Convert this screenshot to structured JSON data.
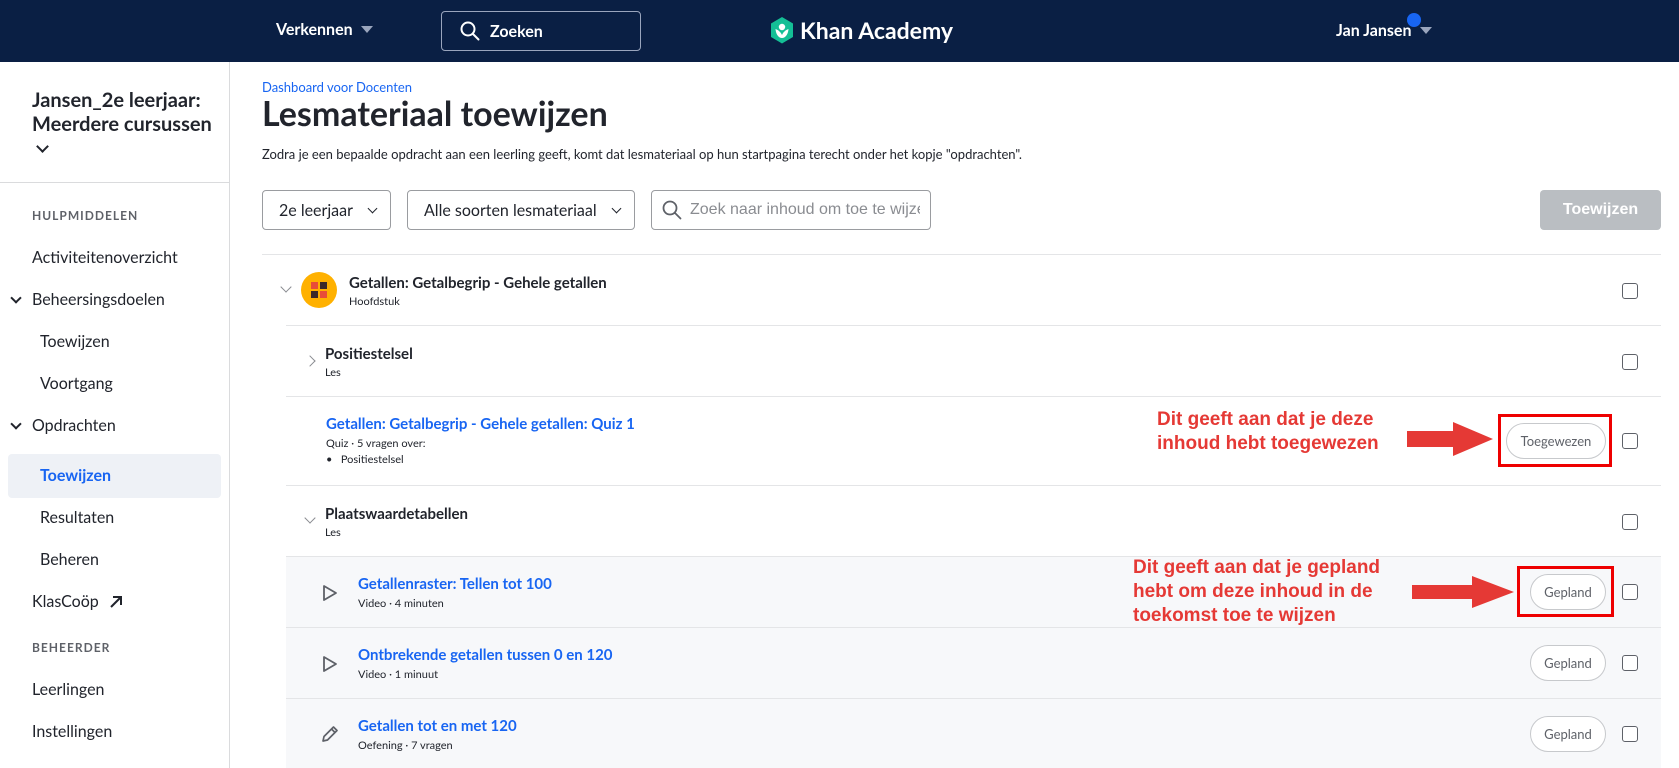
{
  "topbar": {
    "explore_label": "Verkennen",
    "search_label": "Zoeken",
    "logo_text": "Khan Academy",
    "user_name": "Jan Jansen",
    "bg_color": "#0a1f44",
    "logo_color": "#14bf96"
  },
  "sidebar": {
    "class_title": "Jansen_2e leerjaar: Meerdere cursussen",
    "section_tools": "HULPMIDDELEN",
    "items": [
      {
        "label": "Activiteitenoverzicht"
      },
      {
        "label": "Beheersingsdoelen"
      },
      {
        "label": "Toewijzen"
      },
      {
        "label": "Voortgang"
      },
      {
        "label": "Opdrachten"
      },
      {
        "label": "Toewijzen"
      },
      {
        "label": "Resultaten"
      },
      {
        "label": "Beheren"
      },
      {
        "label": "KlasCoöp"
      }
    ],
    "section_admin": "BEHEERDER",
    "admin_items": [
      {
        "label": "Leerlingen"
      },
      {
        "label": "Instellingen"
      }
    ]
  },
  "main": {
    "breadcrumb": "Dashboard voor Docenten",
    "title": "Lesmateriaal toewijzen",
    "description": "Zodra je een bepaalde opdracht aan een leerling geeft, komt dat lesmateriaal op hun startpagina terecht onder het kopje \"opdrachten\".",
    "filters": {
      "grade": "2e leerjaar",
      "type": "Alle soorten lesmateriaal",
      "search_placeholder": "Zoek naar inhoud om toe te wijzen"
    },
    "assign_button": "Toewijzen",
    "rows": [
      {
        "title": "Getallen: Getalbegrip - Gehele getallen",
        "sub": "Hoofdstuk"
      },
      {
        "title": "Positiestelsel",
        "sub": "Les"
      },
      {
        "title": "Getallen: Getalbegrip - Gehele getallen: Quiz 1",
        "sub": "Quiz · 5 vragen over:",
        "bullet": "Positiestelsel",
        "status": "Toegewezen"
      },
      {
        "title": "Plaatswaardetabellen",
        "sub": "Les"
      },
      {
        "title": "Getallenraster: Tellen tot 100",
        "sub": "Video · 4 minuten",
        "status": "Gepland"
      },
      {
        "title": "Ontbrekende getallen tussen 0 en 120",
        "sub": "Video · 1 minuut",
        "status": "Gepland"
      },
      {
        "title": "Getallen tot en met 120",
        "sub": "Oefening · 7 vragen",
        "status": "Gepland"
      }
    ]
  },
  "annotations": {
    "assigned_note_1": "Dit geeft aan dat je deze",
    "assigned_note_2": "inhoud hebt toegewezen",
    "planned_note_1": "Dit geeft aan dat je gepland",
    "planned_note_2": "hebt om deze inhoud in de",
    "planned_note_3": "toekomst toe te wijzen",
    "color": "#e53935"
  }
}
